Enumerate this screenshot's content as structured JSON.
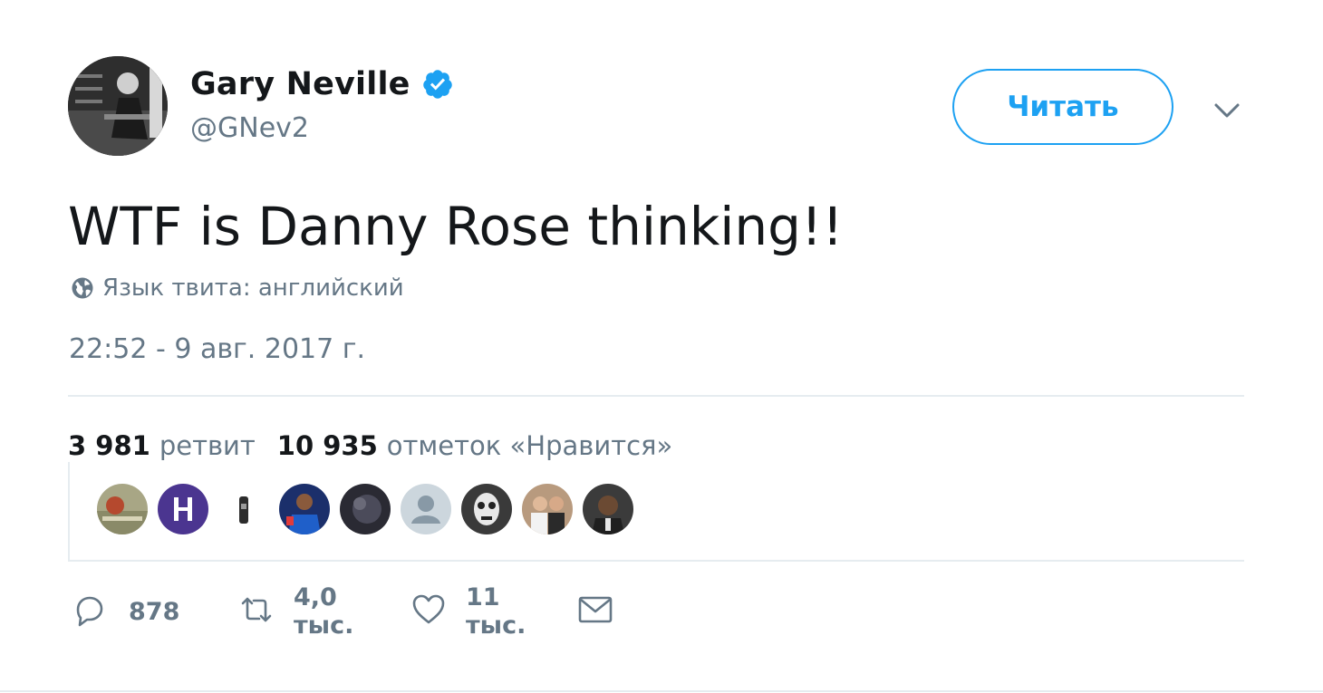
{
  "author": {
    "display_name": "Gary Neville",
    "handle": "@GNev2",
    "verified": true,
    "avatar_icon": "user-avatar"
  },
  "header": {
    "follow_label": "Читать",
    "menu_icon": "chevron-down-icon"
  },
  "tweet": {
    "text": "WTF is Danny Rose thinking!!",
    "language_label": "Язык твита: английский",
    "timestamp": "22:52 - 9 авг. 2017 г."
  },
  "stats": {
    "retweets_count": "3 981",
    "retweets_label": "ретвит",
    "likes_count": "10 935",
    "likes_label": "отметок «Нравится»"
  },
  "liked_by": [
    "liker-1",
    "liker-2",
    "liker-3",
    "liker-4",
    "liker-5",
    "liker-6",
    "liker-7",
    "liker-8",
    "liker-9"
  ],
  "actions": {
    "reply_count": "878",
    "retweet_count": "4,0 тыс.",
    "like_count": "11 тыс."
  },
  "colors": {
    "accent": "#1da1f2",
    "text_primary": "#14171a",
    "text_secondary": "#657786",
    "divider": "#e6ecf0"
  }
}
